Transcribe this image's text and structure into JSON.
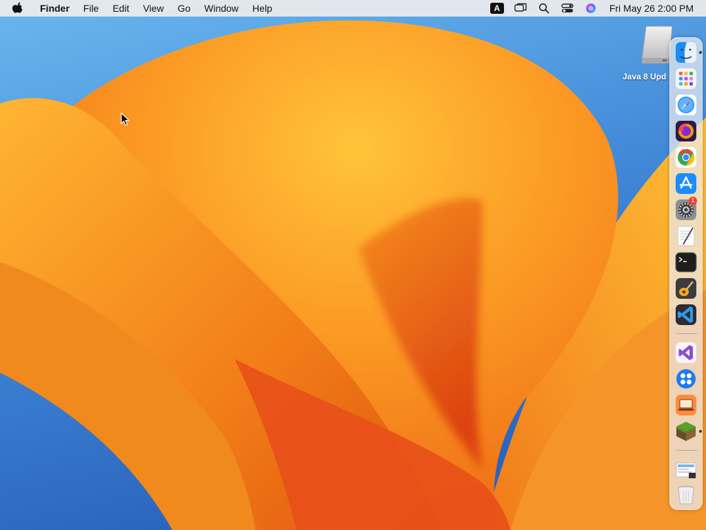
{
  "menubar": {
    "app_name": "Finder",
    "menus": [
      "File",
      "Edit",
      "View",
      "Go",
      "Window",
      "Help"
    ],
    "status_icons": [
      "input-source-icon",
      "screen-mirroring-icon",
      "spotlight-icon",
      "control-center-icon",
      "siri-icon"
    ],
    "input_source_label": "A",
    "clock": "Fri May 26  2:00 PM"
  },
  "desktop": {
    "volume_label": "Java 8 Upd"
  },
  "dock": {
    "apps": [
      {
        "name": "finder-icon",
        "running": true
      },
      {
        "name": "launchpad-icon",
        "running": false
      },
      {
        "name": "safari-icon",
        "running": false
      },
      {
        "name": "firefox-icon",
        "running": false
      },
      {
        "name": "chrome-icon",
        "running": false
      },
      {
        "name": "app-store-icon",
        "running": false
      },
      {
        "name": "system-settings-icon",
        "running": false,
        "badge": "1"
      },
      {
        "name": "textedit-icon",
        "running": false
      },
      {
        "name": "terminal-icon",
        "running": false
      },
      {
        "name": "garageband-icon",
        "running": false
      },
      {
        "name": "vscode-icon",
        "running": false
      },
      {
        "name": "visual-studio-icon",
        "running": false
      },
      {
        "name": "app-icon",
        "running": false
      },
      {
        "name": "presenter-icon",
        "running": false
      },
      {
        "name": "minecraft-icon",
        "running": true
      },
      {
        "name": "downloads-stack-icon",
        "running": false
      },
      {
        "name": "trash-icon",
        "running": false
      }
    ]
  },
  "colors": {
    "wallpaper_orange": "#f08a1c",
    "wallpaper_yellow": "#ffc42e",
    "wallpaper_blue": "#3f86d6",
    "badge_red": "#ff3b30"
  }
}
